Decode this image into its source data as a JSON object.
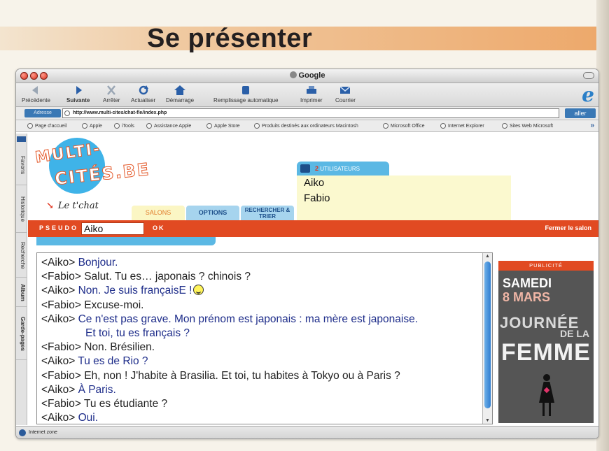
{
  "page": {
    "title": "Se présenter"
  },
  "window": {
    "title": "Google",
    "toolbar": [
      {
        "label": "Précédente",
        "icon": "back-arrow-icon"
      },
      {
        "label": "Suivante",
        "icon": "forward-arrow-icon"
      },
      {
        "label": "Arrêter",
        "icon": "stop-icon"
      },
      {
        "label": "Actualiser",
        "icon": "refresh-icon"
      },
      {
        "label": "Démarrage",
        "icon": "home-icon"
      },
      {
        "label": "Remplissage automatique",
        "icon": "autofill-icon"
      },
      {
        "label": "Imprimer",
        "icon": "print-icon"
      },
      {
        "label": "Courrier",
        "icon": "mail-icon"
      }
    ],
    "address": {
      "label": "Adresse",
      "url": "http://www.multi-cites/chat-fle/index.php",
      "go": "aller"
    },
    "favorites": [
      "Page d'accueil",
      "Apple",
      "iTools",
      "Assistance Apple",
      "Apple Store",
      "Produits destinés aux ordinateurs Macintosh",
      "Microsoft Office",
      "Internet Explorer",
      "Sites Web Microsoft"
    ],
    "sidetabs": [
      "Favoris",
      "Historique",
      "Recherche",
      "Album",
      "Garde-pages"
    ],
    "status": "Internet zone"
  },
  "site": {
    "logo_line1": "MULTI-",
    "logo_line2": "CITÉS.BE",
    "tagline": "Le t'chat",
    "users": {
      "count": "2",
      "label": "UTILISATEURS",
      "names": [
        "Aiko",
        "Fabio"
      ]
    },
    "tabs": {
      "salons": "SALONS",
      "options": "OPTIONS",
      "recherche": "RECHERCHER & TRIER"
    },
    "pseudo": {
      "label": "PSEUDO",
      "value": "Aiko",
      "ok": "OK",
      "close": "Fermer le salon"
    }
  },
  "chat": [
    {
      "speaker": "<Aiko>",
      "text": "Bonjour.",
      "who": "aiko"
    },
    {
      "speaker": "<Fabio>",
      "text": "Salut. Tu es… japonais ? chinois ?",
      "who": "fabio"
    },
    {
      "speaker": "<Aiko>",
      "text": "Non. Je suis françaisE !",
      "who": "aiko",
      "smiley": true
    },
    {
      "speaker": "<Fabio>",
      "text": "Excuse-moi.",
      "who": "fabio"
    },
    {
      "speaker": "<Aiko>",
      "text": "Ce n'est pas grave. Mon prénom est japonais : ma mère est japonaise.",
      "who": "aiko"
    },
    {
      "speaker": "",
      "text": "Et toi, tu es français ?",
      "who": "aiko",
      "continuation": true
    },
    {
      "speaker": "<Fabio>",
      "text": "Non. Brésilien.",
      "who": "fabio"
    },
    {
      "speaker": "<Aiko>",
      "text": "Tu es de Rio ?",
      "who": "aiko"
    },
    {
      "speaker": "<Fabio>",
      "text": "Eh, non ! J'habite à Brasilia. Et toi, tu habites à Tokyo ou à Paris ?",
      "who": "fabio"
    },
    {
      "speaker": "<Aiko>",
      "text": "À Paris.",
      "who": "aiko"
    },
    {
      "speaker": "<Fabio>",
      "text": "Tu es étudiante ?",
      "who": "fabio"
    },
    {
      "speaker": "<Aiko>",
      "text": "Oui.",
      "who": "aiko"
    }
  ],
  "ad": {
    "header": "PUBLICITÉ",
    "line1": "SAMEDI",
    "line2": "8 MARS",
    "line3": "JOURNÉE",
    "line4": "DE LA",
    "line5": "FEMME"
  }
}
